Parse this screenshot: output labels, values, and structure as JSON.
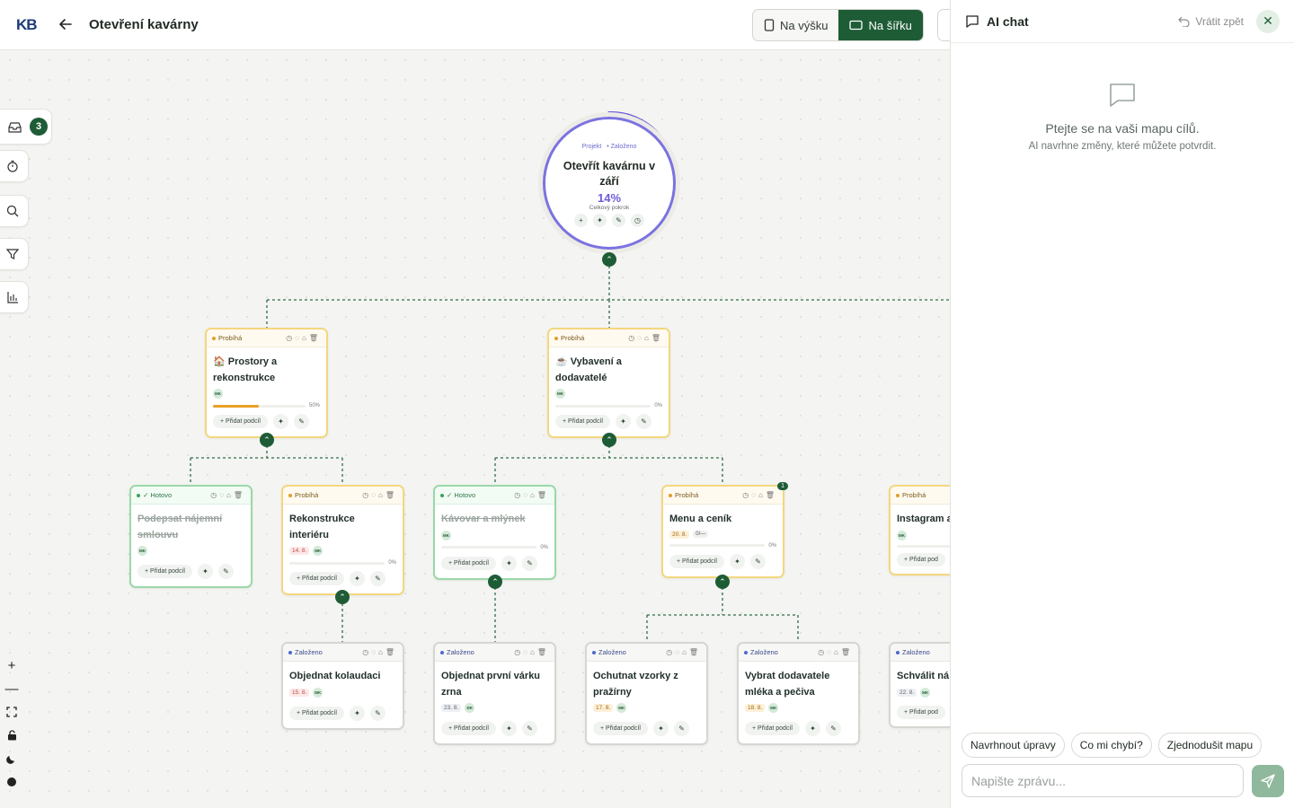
{
  "header": {
    "logo": "KB",
    "title": "Otevření kavárny",
    "view_portrait": "Na výšku",
    "view_landscape": "Na šířku"
  },
  "sidebar": {
    "inbox_count": "3"
  },
  "root": {
    "tag_project": "Projekt",
    "tag_status": "• Založeno",
    "title": "Otevřít kavárnu v září",
    "percent": "14%",
    "progress_label": "Celkový pokrok",
    "progress_fraction": 0.14
  },
  "ui": {
    "add_sub": "+ Přidat podcíl"
  },
  "cards": {
    "c1": {
      "status": "Probíhá",
      "title": "🏠 Prostory a rekonstrukce",
      "avatar": "MK",
      "progress": "50%",
      "progress_value": 0.5
    },
    "c2": {
      "status": "Probíhá",
      "title": "☕ Vybavení a dodavatelé",
      "avatar": "MK",
      "progress": "0%",
      "progress_value": 0
    },
    "c3": {
      "status": "✓ Hotovo",
      "title": "Podepsat nájemní smlouvu",
      "avatar": "MK"
    },
    "c4": {
      "status": "Probíhá",
      "title": "Rekonstrukce interiéru",
      "date": "14. 8.",
      "avatar": "MK",
      "progress": "0%",
      "progress_value": 0
    },
    "c5": {
      "status": "✓ Hotovo",
      "title": "Kávovar a mlýnek",
      "avatar": "MK",
      "progress": "0%",
      "progress_value": 0
    },
    "c6": {
      "status": "Probíhá",
      "title": "Menu a ceník",
      "date": "20. 8.",
      "mini": "0/—",
      "progress": "0%",
      "progress_value": 0,
      "comments": "1"
    },
    "c7": {
      "status": "Probíhá",
      "title": "Instagram a",
      "avatar": "MK",
      "add_sub": "+ Přidat pod"
    },
    "c8": {
      "status": "Založeno",
      "title": "Objednat kolaudaci",
      "date": "15. 8.",
      "avatar": "MK"
    },
    "c9": {
      "status": "Založeno",
      "title": "Objednat první várku zrna",
      "date": "23. 8.",
      "avatar": "DK"
    },
    "c10": {
      "status": "Založeno",
      "title": "Ochutnat vzorky z pražírny",
      "date": "17. 8.",
      "avatar": "MK"
    },
    "c11": {
      "status": "Založeno",
      "title": "Vybrat dodavatele mléka a pečiva",
      "date": "18. 8.",
      "avatar": "MK"
    },
    "c12": {
      "status": "Založeno",
      "title": "Schválit ná",
      "date": "22. 8.",
      "avatar": "MK",
      "add_sub": "+ Přidat pod"
    }
  },
  "chat": {
    "title": "AI chat",
    "undo": "Vrátit zpět",
    "empty_title": "Ptejte se na vaši mapu cílů.",
    "empty_sub": "AI navrhne změny, které můžete potvrdit.",
    "suggestions": [
      "Navrhnout úpravy",
      "Co mi chybí?",
      "Zjednodušit mapu"
    ],
    "placeholder": "Napište zprávu..."
  },
  "colors": {
    "accent": "#1e5c36",
    "progress": "#e9a023",
    "root_ring": "#7b73e0"
  }
}
